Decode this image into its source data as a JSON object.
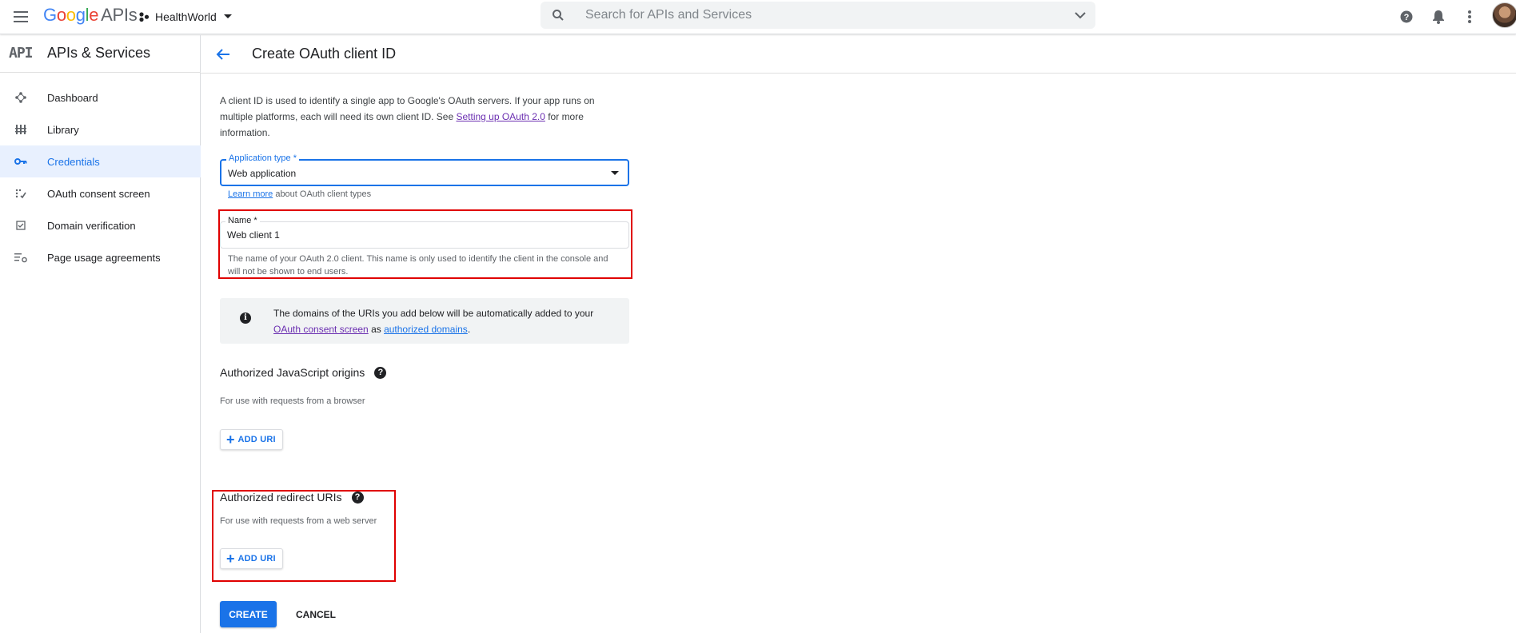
{
  "header": {
    "logo_google": [
      "G",
      "o",
      "o",
      "g",
      "l",
      "e"
    ],
    "logo_colors": [
      "#4285f4",
      "#ea4335",
      "#fbbc05",
      "#4285f4",
      "#34a853",
      "#ea4335"
    ],
    "logo_apis": "APIs",
    "project_name": "HealthWorld",
    "search_placeholder": "Search for APIs and Services"
  },
  "sidebar": {
    "title": "APIs & Services",
    "api_logo": "API",
    "items": [
      {
        "label": "Dashboard",
        "icon": "dashboard-icon",
        "active": false
      },
      {
        "label": "Library",
        "icon": "library-icon",
        "active": false
      },
      {
        "label": "Credentials",
        "icon": "key-icon",
        "active": true
      },
      {
        "label": "OAuth consent screen",
        "icon": "consent-icon",
        "active": false
      },
      {
        "label": "Domain verification",
        "icon": "checkbox-icon",
        "active": false
      },
      {
        "label": "Page usage agreements",
        "icon": "settings-list-icon",
        "active": false
      }
    ]
  },
  "page": {
    "title": "Create OAuth client ID",
    "intro_text_1": "A client ID is used to identify a single app to Google's OAuth servers. If your app runs on multiple platforms, each will need its own client ID. See ",
    "intro_link": "Setting up OAuth 2.0",
    "intro_text_2": " for more information.",
    "app_type_label": "Application type *",
    "app_type_value": "Web application",
    "learn_more_link": "Learn more",
    "learn_more_text": " about OAuth client types",
    "name_label": "Name *",
    "name_value": "Web client 1",
    "name_help": "The name of your OAuth 2.0 client. This name is only used to identify the client in the console and will not be shown to end users.",
    "info_text_1": "The domains of the URIs you add below will be automatically added to your ",
    "info_link_1": "OAuth consent screen",
    "info_text_2": " as ",
    "info_link_2": "authorized domains",
    "info_text_3": ".",
    "js_origins_title": "Authorized JavaScript origins",
    "js_origins_sub": "For use with requests from a browser",
    "redirect_title": "Authorized redirect URIs",
    "redirect_sub": "For use with requests from a web server",
    "add_uri_label": "ADD URI",
    "create_label": "CREATE",
    "cancel_label": "CANCEL"
  },
  "colors": {
    "accent": "#1a73e8",
    "highlight": "#e00000",
    "active_nav_bg": "#e8f0fe"
  }
}
